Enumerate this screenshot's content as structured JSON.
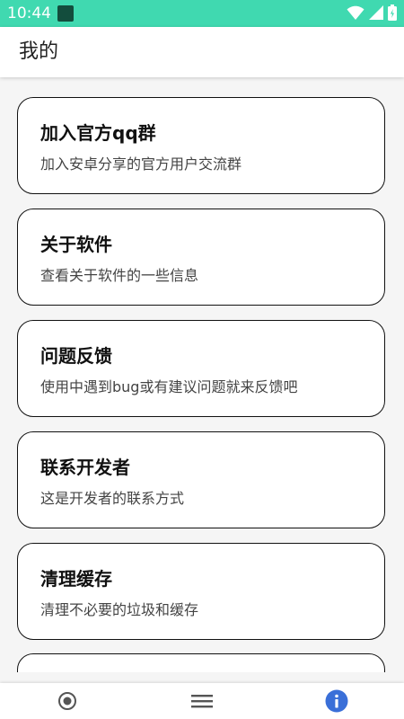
{
  "status_bar": {
    "time": "10:44",
    "icons": [
      "app-notification-icon",
      "wifi-icon",
      "signal-icon",
      "battery-icon"
    ]
  },
  "app_bar": {
    "title": "我的"
  },
  "cards": [
    {
      "title": "加入官方qq群",
      "subtitle": "加入安卓分享的官方用户交流群"
    },
    {
      "title": "关于软件",
      "subtitle": "查看关于软件的一些信息"
    },
    {
      "title": "问题反馈",
      "subtitle": "使用中遇到bug或有建议问题就来反馈吧"
    },
    {
      "title": "联系开发者",
      "subtitle": "这是开发者的联系方式"
    },
    {
      "title": "清理缓存",
      "subtitle": "清理不必要的垃圾和缓存"
    },
    {
      "title": "",
      "subtitle": ""
    }
  ],
  "bottom_nav": {
    "items": [
      {
        "icon": "radio-circle-icon",
        "selected": false
      },
      {
        "icon": "menu-icon",
        "selected": false
      },
      {
        "icon": "info-icon",
        "selected": true
      }
    ]
  },
  "colors": {
    "status_bar": "#40d9b0",
    "accent": "#3a6fd8",
    "background": "#f5f5f5",
    "card_border": "#111111"
  }
}
